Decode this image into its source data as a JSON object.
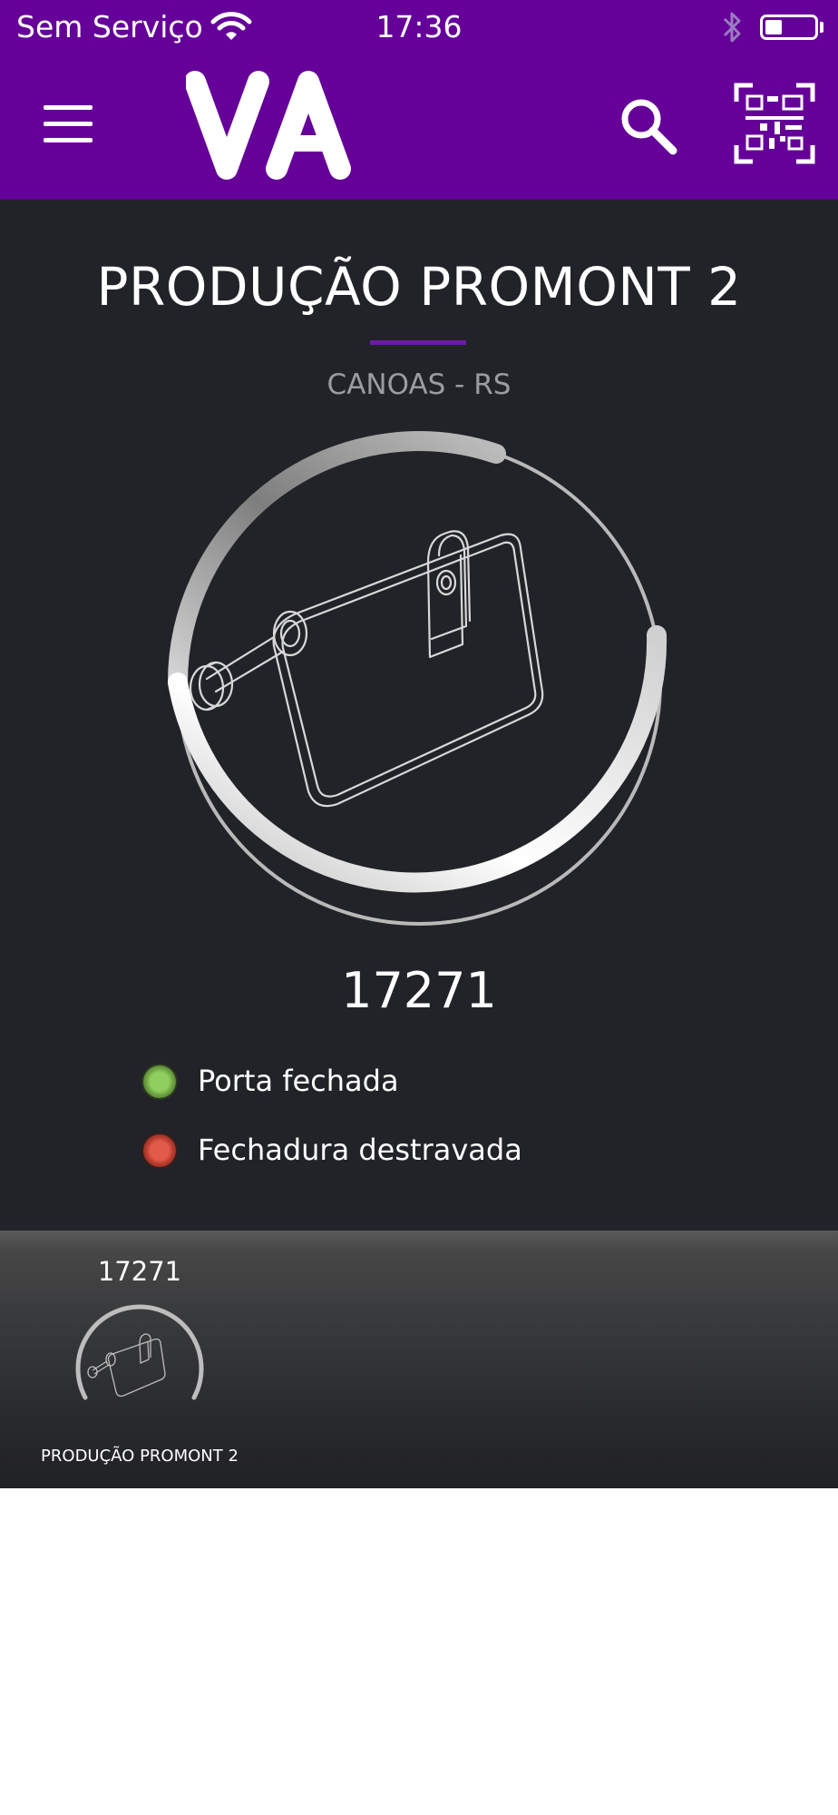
{
  "status_bar": {
    "carrier": "Sem Serviço",
    "time": "17:36",
    "battery_level": 0.3
  },
  "header": {
    "logo_text": "VA",
    "icons": [
      "menu-icon",
      "search-icon",
      "qr-code-icon"
    ],
    "background_color": "#650099"
  },
  "lock": {
    "title": "PRODUÇÃO PROMONT 2",
    "location": "CANOAS - RS",
    "id": "17271",
    "statuses": [
      {
        "label": "Porta fechada",
        "color": "#7ab648"
      },
      {
        "label": "Fechadura destravada",
        "color": "#c9463a"
      }
    ]
  },
  "dock": {
    "items": [
      {
        "id": "17271",
        "name": "PRODUÇÃO PROMONT 2"
      }
    ]
  },
  "colors": {
    "panel_bg": "#212328",
    "accent_purple": "#6c1aa6"
  }
}
